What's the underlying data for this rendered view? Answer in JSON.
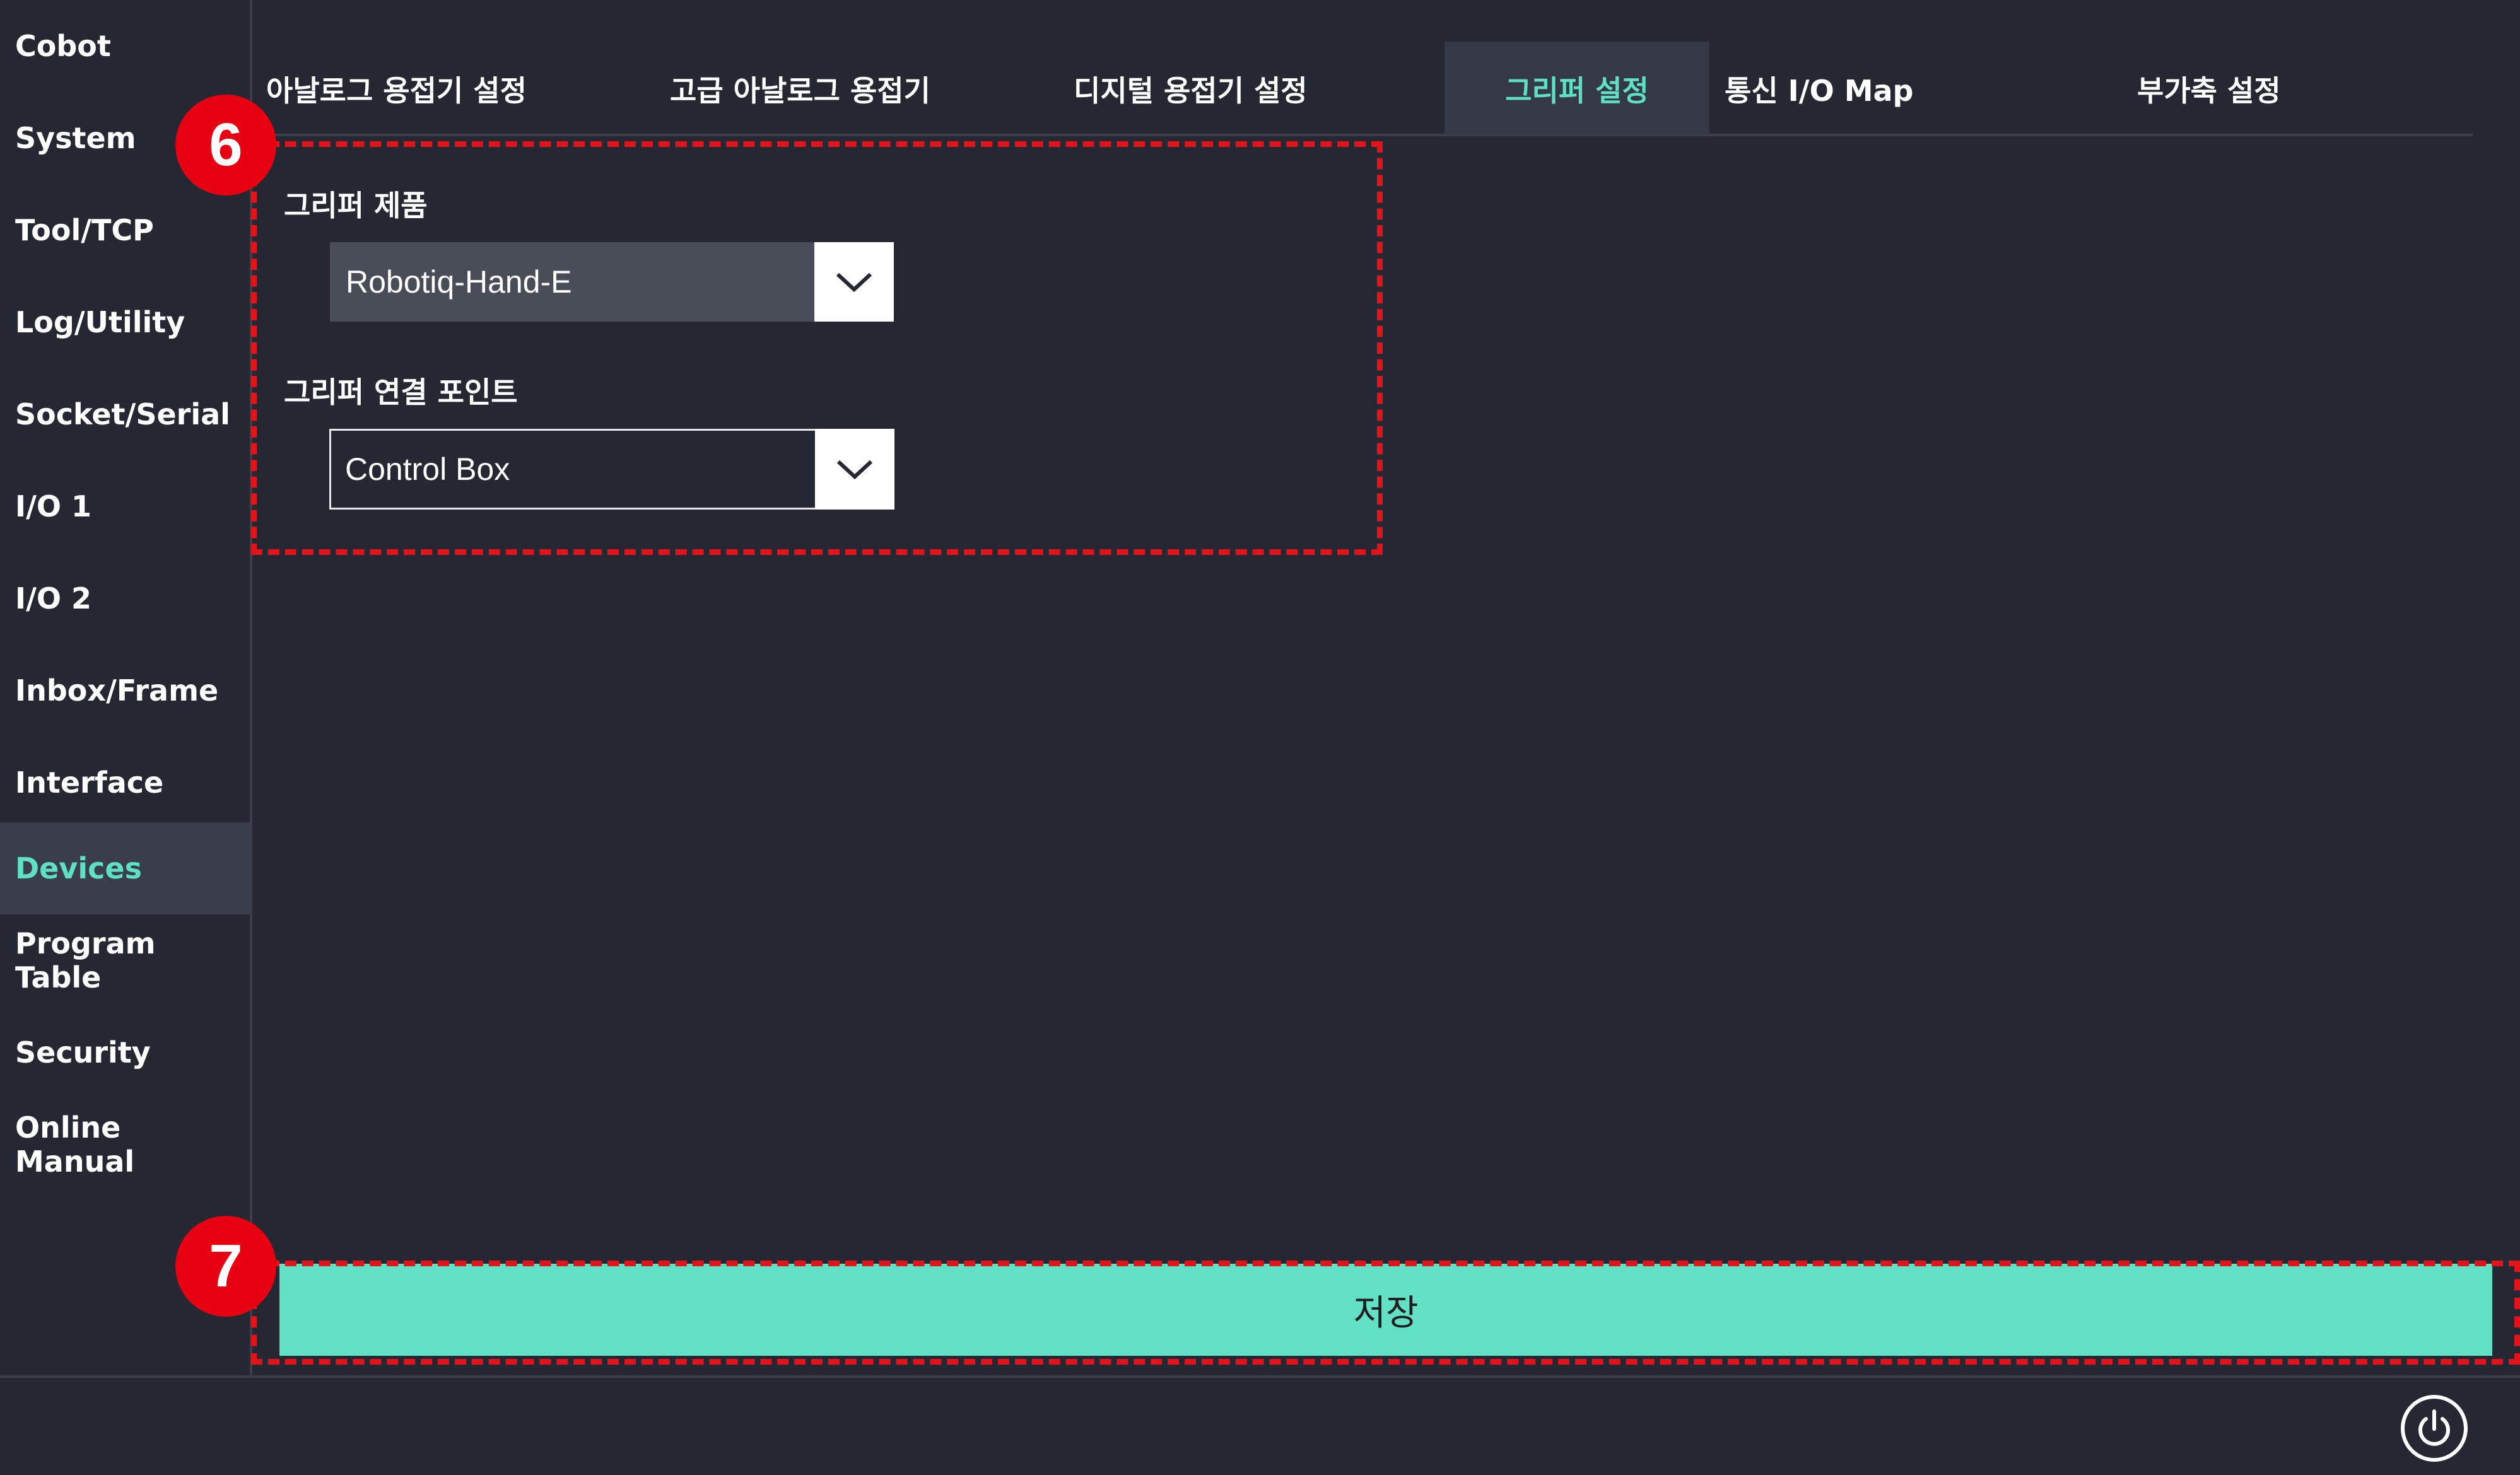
{
  "sidebar": {
    "items": [
      {
        "label": "Cobot"
      },
      {
        "label": "System"
      },
      {
        "label": "Tool/TCP"
      },
      {
        "label": "Log/Utility"
      },
      {
        "label": "Socket/Serial"
      },
      {
        "label": "I/O 1"
      },
      {
        "label": "I/O 2"
      },
      {
        "label": "Inbox/Frame"
      },
      {
        "label": "Interface"
      },
      {
        "label": "Devices",
        "active": true
      },
      {
        "label": "Program Table"
      },
      {
        "label": "Security"
      },
      {
        "label": "Online Manual"
      }
    ]
  },
  "tabs": [
    {
      "label": "아날로그 용접기 설정"
    },
    {
      "label": "고급 아날로그 용접기"
    },
    {
      "label": "디지털 용접기 설정"
    },
    {
      "label": "그리퍼 설정",
      "active": true
    },
    {
      "label": "통신 I/O Map"
    },
    {
      "label": "부가축 설정"
    }
  ],
  "gripper": {
    "product_label": "그리퍼 제품",
    "product_value": "Robotiq-Hand-E",
    "connection_label": "그리퍼 연결 포인트",
    "connection_value": "Control Box"
  },
  "annotations": {
    "badge_6": "6",
    "badge_7": "7"
  },
  "save_label": "저장",
  "icons": {
    "dropdown": "chevron-down-icon",
    "power": "power-icon"
  },
  "colors": {
    "background": "#252833",
    "accent": "#5fe0c3",
    "save_button": "#61e0c4",
    "annotation": "#e0141a"
  }
}
